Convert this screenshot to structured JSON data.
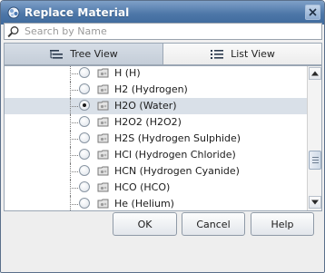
{
  "window": {
    "title": "Replace Material",
    "icons": {
      "app": "material-app-icon",
      "close": "close-icon"
    }
  },
  "search": {
    "placeholder": "Search by Name",
    "value": "",
    "icon": "search-magnifier-icon"
  },
  "tabs": [
    {
      "label": "Tree View",
      "active": true,
      "icon": "tree-view-icon"
    },
    {
      "label": "List View",
      "active": false,
      "icon": "list-view-icon"
    }
  ],
  "materials": [
    {
      "label": "H (H)",
      "selected": false,
      "icon": "folder-material-icon"
    },
    {
      "label": "H2 (Hydrogen)",
      "selected": false,
      "icon": "folder-material-icon"
    },
    {
      "label": "H2O (Water)",
      "selected": true,
      "icon": "folder-material-icon"
    },
    {
      "label": "H2O2 (H2O2)",
      "selected": false,
      "icon": "folder-material-icon"
    },
    {
      "label": "H2S (Hydrogen Sulphide)",
      "selected": false,
      "icon": "folder-material-icon"
    },
    {
      "label": "HCl (Hydrogen Chloride)",
      "selected": false,
      "icon": "folder-material-icon"
    },
    {
      "label": "HCN (Hydrogen Cyanide)",
      "selected": false,
      "icon": "folder-material-icon"
    },
    {
      "label": "HCO (HCO)",
      "selected": false,
      "icon": "folder-material-icon"
    },
    {
      "label": "He (Helium)",
      "selected": false,
      "icon": "folder-material-icon"
    }
  ],
  "scrollbar": {
    "up_icon": "scroll-up-arrow-icon",
    "down_icon": "scroll-down-arrow-icon"
  },
  "buttons": {
    "ok": "OK",
    "cancel": "Cancel",
    "help": "Help"
  },
  "colors": {
    "titlebar": "#4d77a8",
    "selected_row": "#d9e0e8",
    "active_tab": "#c4cdd8"
  }
}
